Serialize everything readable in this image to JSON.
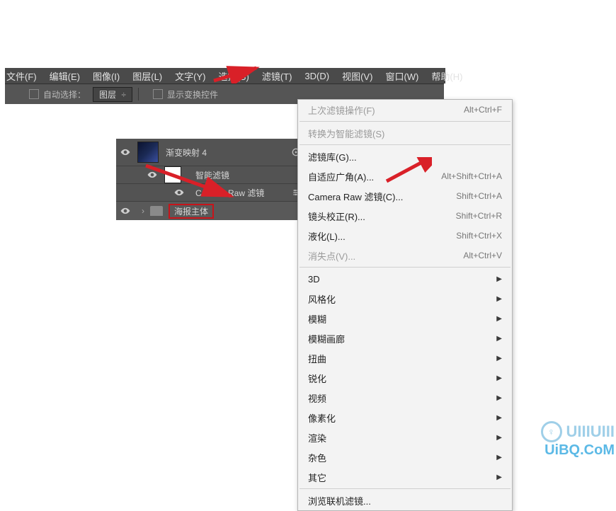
{
  "menubar": {
    "file": "文件(F)",
    "edit": "编辑(E)",
    "image": "图像(I)",
    "layer": "图层(L)",
    "type": "文字(Y)",
    "select": "选择(S)",
    "filter": "滤镜(T)",
    "threeD": "3D(D)",
    "view": "视图(V)",
    "window": "窗口(W)",
    "help": "帮助(H)"
  },
  "optionsbar": {
    "autoSelect": "自动选择：",
    "mode": "图层",
    "showTransform": "显示变换控件"
  },
  "layers": {
    "adj": "渐变映射 4",
    "smart": "智能滤镜",
    "cameraRaw": "Camera Raw 滤镜",
    "group": "海报主体"
  },
  "filterMenu": {
    "last": "上次滤镜操作(F)",
    "lastSc": "Alt+Ctrl+F",
    "convert": "转换为智能滤镜(S)",
    "gallery": "滤镜库(G)...",
    "adaptive": "自适应广角(A)...",
    "adaptiveSc": "Alt+Shift+Ctrl+A",
    "cameraRaw": "Camera Raw 滤镜(C)...",
    "cameraRawSc": "Shift+Ctrl+A",
    "lens": "镜头校正(R)...",
    "lensSc": "Shift+Ctrl+R",
    "liquify": "液化(L)...",
    "liquifySc": "Shift+Ctrl+X",
    "vanish": "消失点(V)...",
    "vanishSc": "Alt+Ctrl+V",
    "threeD": "3D",
    "stylize": "风格化",
    "blur": "模糊",
    "blurGallery": "模糊画廊",
    "distort": "扭曲",
    "sharpen": "锐化",
    "video": "视频",
    "pixelate": "像素化",
    "render": "渲染",
    "noise": "杂色",
    "other": "其它",
    "browse": "浏览联机滤镜..."
  },
  "watermark": {
    "top": "UIIIUIII",
    "bottom": "UiBQ.CoM"
  }
}
